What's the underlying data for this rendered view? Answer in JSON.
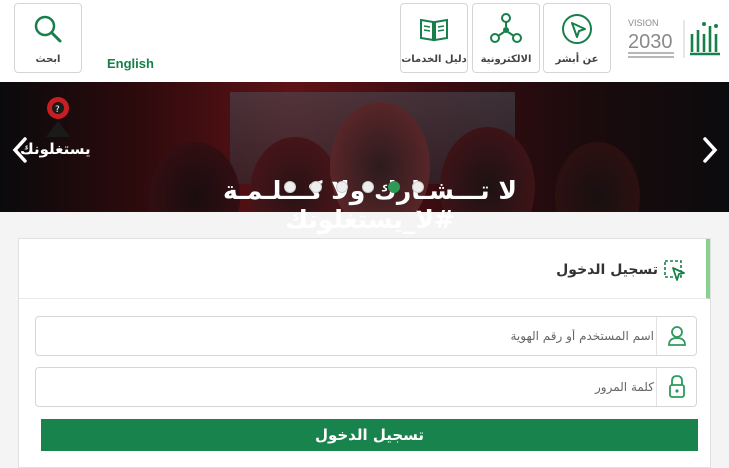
{
  "header": {
    "tiles": [
      {
        "id": "search",
        "label": "ابحث",
        "icon": "search-icon"
      },
      {
        "id": "services-guide",
        "label": "دليل الخدمات",
        "icon": "book-icon"
      },
      {
        "id": "e-services",
        "label": "الالكترونية",
        "icon": "network-icon"
      },
      {
        "id": "about-absher",
        "label": "عن أبشر",
        "icon": "cursor-circle-icon"
      }
    ],
    "language_link": "English"
  },
  "banner": {
    "text": "لا تـــشـارك ولا كـــلـمـة #لا_يستغلونك",
    "brand": "يستغلونك",
    "slides_count": 6,
    "active_slide": 3
  },
  "login": {
    "title": "تسجيل الدخول",
    "username_placeholder": "اسم المستخدم أو رقم الهوية",
    "password_placeholder": "كلمة المرور",
    "submit_label": "تسجيل الدخول"
  },
  "colors": {
    "brand_green": "#18834c",
    "accent_green": "#8ad18f",
    "banner_red": "#5e1216"
  }
}
